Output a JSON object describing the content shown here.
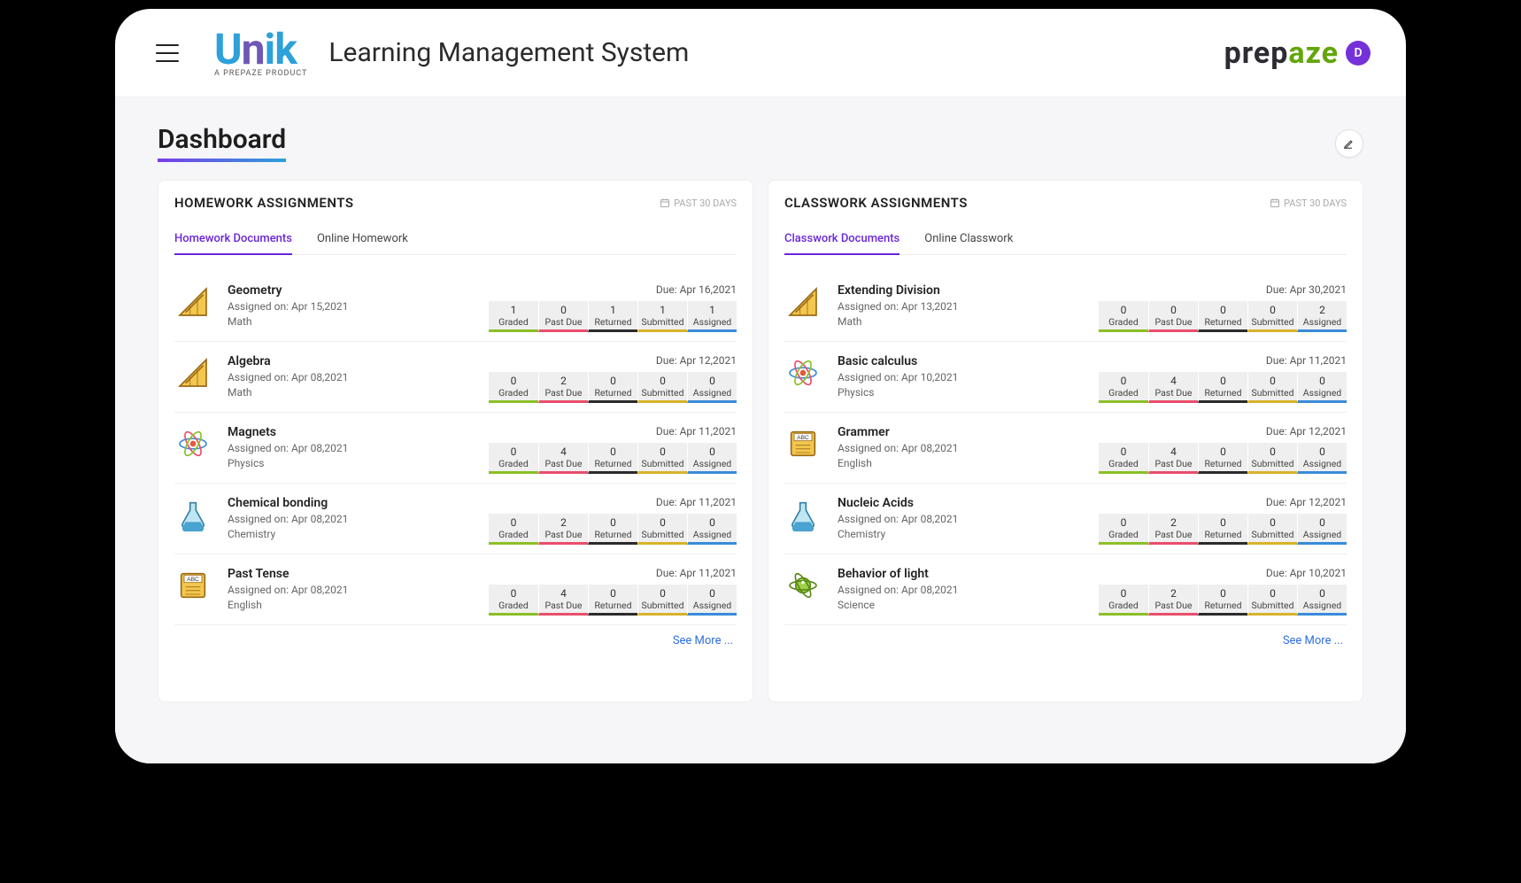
{
  "header": {
    "brand_sub": "A PREPAZE PRODUCT",
    "app_title": "Learning Management System",
    "prepaze": "prepaze",
    "avatar_letter": "D"
  },
  "dashboard_title": "Dashboard",
  "stat_labels": {
    "graded": "Graded",
    "pastdue": "Past Due",
    "returned": "Returned",
    "submitted": "Submitted",
    "assigned": "Assigned"
  },
  "see_more": "See More ...",
  "panels": [
    {
      "title": "HOMEWORK ASSIGNMENTS",
      "past_label": "PAST 30 DAYS",
      "tabs": [
        "Homework Documents",
        "Online Homework"
      ],
      "active_tab": 0,
      "rows": [
        {
          "icon": "math",
          "title": "Geometry",
          "assigned": "Assigned on: Apr 15,2021",
          "subject": "Math",
          "due": "Due: Apr 16,2021",
          "stats": {
            "graded": "1",
            "pastdue": "0",
            "returned": "1",
            "submitted": "1",
            "assigned": "1"
          }
        },
        {
          "icon": "math",
          "title": "Algebra",
          "assigned": "Assigned on: Apr 08,2021",
          "subject": "Math",
          "due": "Due: Apr 12,2021",
          "stats": {
            "graded": "0",
            "pastdue": "2",
            "returned": "0",
            "submitted": "0",
            "assigned": "0"
          }
        },
        {
          "icon": "physics",
          "title": "Magnets",
          "assigned": "Assigned on: Apr 08,2021",
          "subject": "Physics",
          "due": "Due: Apr 11,2021",
          "stats": {
            "graded": "0",
            "pastdue": "4",
            "returned": "0",
            "submitted": "0",
            "assigned": "0"
          }
        },
        {
          "icon": "chemistry",
          "title": "Chemical bonding",
          "assigned": "Assigned on: Apr 08,2021",
          "subject": "Chemistry",
          "due": "Due: Apr 11,2021",
          "stats": {
            "graded": "0",
            "pastdue": "2",
            "returned": "0",
            "submitted": "0",
            "assigned": "0"
          }
        },
        {
          "icon": "english",
          "title": "Past Tense",
          "assigned": "Assigned on: Apr 08,2021",
          "subject": "English",
          "due": "Due: Apr 11,2021",
          "stats": {
            "graded": "0",
            "pastdue": "4",
            "returned": "0",
            "submitted": "0",
            "assigned": "0"
          }
        }
      ]
    },
    {
      "title": "CLASSWORK ASSIGNMENTS",
      "past_label": "PAST 30 DAYS",
      "tabs": [
        "Classwork Documents",
        "Online Classwork"
      ],
      "active_tab": 0,
      "rows": [
        {
          "icon": "math",
          "title": "Extending Division",
          "assigned": "Assigned on: Apr 13,2021",
          "subject": "Math",
          "due": "Due: Apr 30,2021",
          "stats": {
            "graded": "0",
            "pastdue": "0",
            "returned": "0",
            "submitted": "0",
            "assigned": "2"
          }
        },
        {
          "icon": "physics",
          "title": "Basic calculus",
          "assigned": "Assigned on: Apr 10,2021",
          "subject": "Physics",
          "due": "Due: Apr 11,2021",
          "stats": {
            "graded": "0",
            "pastdue": "4",
            "returned": "0",
            "submitted": "0",
            "assigned": "0"
          }
        },
        {
          "icon": "english",
          "title": "Grammer",
          "assigned": "Assigned on: Apr 08,2021",
          "subject": "English",
          "due": "Due: Apr 12,2021",
          "stats": {
            "graded": "0",
            "pastdue": "4",
            "returned": "0",
            "submitted": "0",
            "assigned": "0"
          }
        },
        {
          "icon": "chemistry",
          "title": "Nucleic Acids",
          "assigned": "Assigned on: Apr 08,2021",
          "subject": "Chemistry",
          "due": "Due: Apr 12,2021",
          "stats": {
            "graded": "0",
            "pastdue": "2",
            "returned": "0",
            "submitted": "0",
            "assigned": "0"
          }
        },
        {
          "icon": "science",
          "title": "Behavior of light",
          "assigned": "Assigned on: Apr 08,2021",
          "subject": "Science",
          "due": "Due: Apr 10,2021",
          "stats": {
            "graded": "0",
            "pastdue": "2",
            "returned": "0",
            "submitted": "0",
            "assigned": "0"
          }
        }
      ]
    }
  ]
}
